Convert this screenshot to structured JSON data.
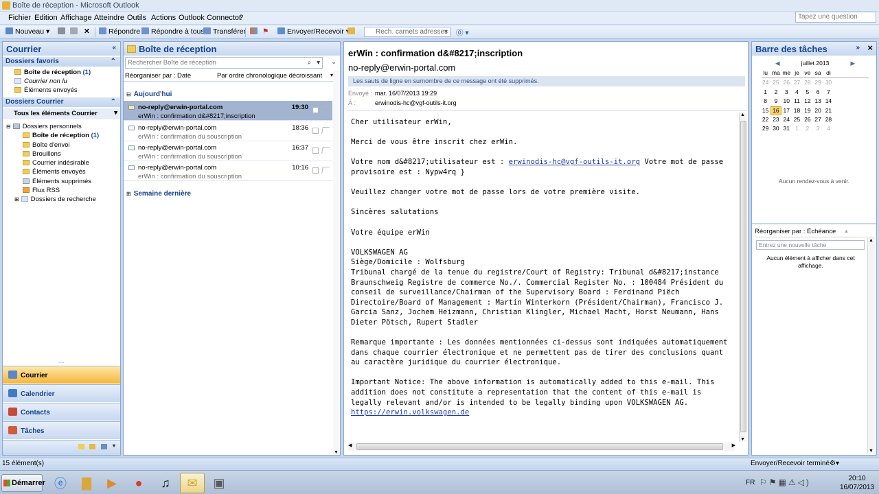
{
  "window": {
    "title": "Boîte de réception - Microsoft Outlook"
  },
  "menu": [
    "Fichier",
    "Edition",
    "Affichage",
    "Atteindre",
    "Outils",
    "Actions",
    "Outlook Connector",
    "?"
  ],
  "ask": {
    "placeholder": "Tapez une question"
  },
  "toolbar": {
    "new": "Nouveau",
    "reply": "Répondre",
    "reply_all": "Répondre à tous",
    "forward": "Transférer",
    "send_receive": "Envoyer/Recevoir",
    "address_search": "Rech. carnets adresses"
  },
  "nav": {
    "title": "Courrier",
    "favorites_header": "Dossiers favoris",
    "favorites": [
      {
        "label": "Boîte de réception",
        "count": "(1)"
      },
      {
        "label": "Courrier non lu"
      },
      {
        "label": "Éléments envoyés"
      }
    ],
    "mail_header": "Dossiers Courrier",
    "all_items": "Tous les éléments Courrier",
    "personal": "Dossiers personnels",
    "folders": [
      {
        "label": "Boîte de réception",
        "count": "(1)"
      },
      {
        "label": "Boîte d'envoi"
      },
      {
        "label": "Brouillons"
      },
      {
        "label": "Courrier indésirable"
      },
      {
        "label": "Éléments envoyés"
      },
      {
        "label": "Éléments supprimés"
      },
      {
        "label": "Flux RSS"
      }
    ],
    "search_folders": "Dossiers de recherche",
    "buttons": [
      "Courrier",
      "Calendrier",
      "Contacts",
      "Tâches"
    ]
  },
  "list": {
    "title": "Boîte de réception",
    "search_placeholder": "Rechercher Boîte de réception",
    "arrange_by": "Réorganiser par : Date",
    "order": "Par ordre chronologique décroissant",
    "group_today": "Aujourd'hui",
    "group_last_week": "Semaine dernière",
    "messages": [
      {
        "from": "no-reply@erwin-portal.com",
        "subject": "erWin : confirmation d&#8217;inscription",
        "time": "19:30"
      },
      {
        "from": "no-reply@erwin-portal.com",
        "subject": "erWin : confirmation du souscription",
        "time": "18:36"
      },
      {
        "from": "no-reply@erwin-portal.com",
        "subject": "erWin : confirmation du souscription",
        "time": "16:37"
      },
      {
        "from": "no-reply@erwin-portal.com",
        "subject": "erWin : confirmation du souscription",
        "time": "10:16"
      }
    ]
  },
  "reading": {
    "subject": "erWin : confirmation d&#8217;inscription",
    "sender": "no-reply@erwin-portal.com",
    "info": "Les sauts de ligne en surnombre de ce message ont été supprimés.",
    "sent_label": "Envoyé :",
    "sent_value": "mar. 16/07/2013 19:29",
    "to_label": "À :",
    "to_value": "erwinodis-hc@vgf-outils-it.org",
    "body_greeting": "Cher utilisateur erWin,\n\nMerci de vous être inscrit chez erWin.\n\nVotre nom d&#8217;utilisateur est : ",
    "body_email": "erwinodis-hc@vgf-outils-it.org",
    "body_main": " Votre mot de passe provisoire est : Nypw4rq }\n\nVeuillez changer votre mot de passe lors de votre première visite.\n\nSincères salutations\n\nVotre équipe erWin\n\nVOLKSWAGEN AG\nSiège/Domicile : Wolfsburg\nTribunal chargé de la tenue du registre/Court of Registry: Tribunal d&#8217;instance Braunschweig Registre de commerce No./. Commercial Register No. : 100484 Président du conseil de surveillance/Chairman of the Supervisory Board : Ferdinand Piëch Directoire/Board of Management : Martin Winterkorn (Président/Chairman), Francisco J. Garcia Sanz, Jochem Heizmann, Christian Klingler, Michael Macht, Horst Neumann, Hans Dieter Pötsch, Rupert Stadler\n\nRemarque importante : Les données mentionnées ci-dessus sont indiquées automatiquement dans chaque courrier électronique et ne permettent pas de tirer des conclusions quant au caractère juridique du courrier électronique.\n\nImportant Notice: The above information is automatically added to this e-mail. This addition does not constitute a representation that the content of this e-mail is legally relevant and/or is intended to be legally binding upon VOLKSWAGEN AG.\n",
    "body_link": "https://erwin.volkswagen.de"
  },
  "todo": {
    "title": "Barre des tâches",
    "month": "juillet 2013",
    "weekdays": [
      "lu",
      "ma",
      "me",
      "je",
      "ve",
      "sa",
      "di"
    ],
    "weeks": [
      [
        [
          "24",
          1
        ],
        [
          "25",
          1
        ],
        [
          "26",
          1
        ],
        [
          "27",
          1
        ],
        [
          "28",
          1
        ],
        [
          "29",
          1
        ],
        [
          "30",
          1
        ]
      ],
      [
        [
          "1",
          0
        ],
        [
          "2",
          0
        ],
        [
          "3",
          0
        ],
        [
          "4",
          0
        ],
        [
          "5",
          0
        ],
        [
          "6",
          0
        ],
        [
          "7",
          0
        ]
      ],
      [
        [
          "8",
          0
        ],
        [
          "9",
          0
        ],
        [
          "10",
          0
        ],
        [
          "11",
          0
        ],
        [
          "12",
          0
        ],
        [
          "13",
          0
        ],
        [
          "14",
          0
        ]
      ],
      [
        [
          "15",
          0
        ],
        [
          "16",
          2
        ],
        [
          "17",
          0
        ],
        [
          "18",
          0
        ],
        [
          "19",
          0
        ],
        [
          "20",
          0
        ],
        [
          "21",
          0
        ]
      ],
      [
        [
          "22",
          0
        ],
        [
          "23",
          0
        ],
        [
          "24",
          0
        ],
        [
          "25",
          0
        ],
        [
          "26",
          0
        ],
        [
          "27",
          0
        ],
        [
          "28",
          0
        ]
      ],
      [
        [
          "29",
          0
        ],
        [
          "30",
          0
        ],
        [
          "31",
          0
        ],
        [
          "1",
          1
        ],
        [
          "2",
          1
        ],
        [
          "3",
          1
        ],
        [
          "4",
          1
        ]
      ]
    ],
    "no_appointments": "Aucun rendez-vous à venir.",
    "task_arrange": "Réorganiser par : Échéance",
    "task_placeholder": "Entrez une nouvelle tâche",
    "no_tasks": "Aucun élément à afficher dans cet affichage."
  },
  "status": {
    "count": "15 élément(s)",
    "sync": "Envoyer/Recevoir terminé"
  },
  "taskbar": {
    "start": "Démarrer",
    "lang": "FR",
    "time": "20:10",
    "date": "16/07/2013"
  }
}
